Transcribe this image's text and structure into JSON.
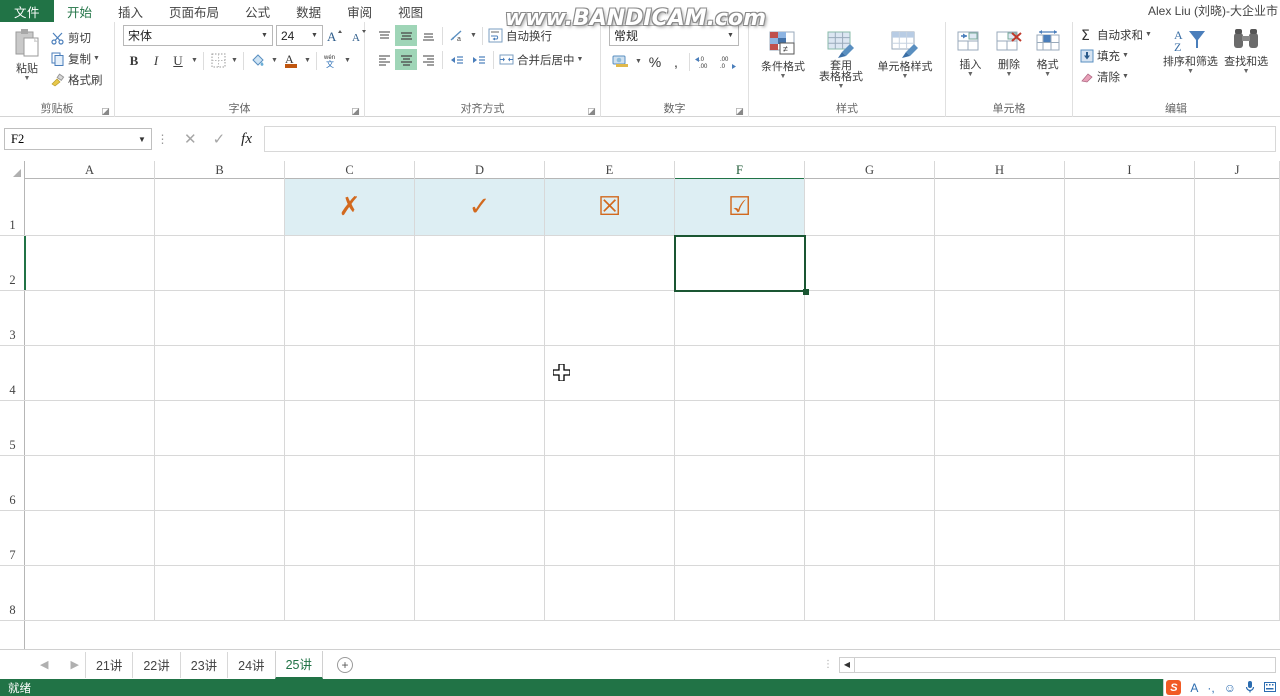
{
  "app": {
    "user_label": "Alex Liu (刘晓)-大企业市",
    "watermark": "www.BANDICAM.com"
  },
  "ribbon": {
    "tabs": [
      {
        "label": "文件",
        "kind": "file"
      },
      {
        "label": "开始",
        "kind": "active"
      },
      {
        "label": "插入",
        "kind": "normal"
      },
      {
        "label": "页面布局",
        "kind": "normal"
      },
      {
        "label": "公式",
        "kind": "normal"
      },
      {
        "label": "数据",
        "kind": "normal"
      },
      {
        "label": "审阅",
        "kind": "normal"
      },
      {
        "label": "视图",
        "kind": "normal"
      }
    ],
    "groups": {
      "clipboard": {
        "title": "剪贴板",
        "paste": "粘贴",
        "cut": "剪切",
        "copy": "复制",
        "format_painter": "格式刷"
      },
      "font": {
        "title": "字体",
        "font_name": "宋体",
        "font_size": "24",
        "grow": "A",
        "shrink": "A",
        "bold": "B",
        "italic": "I",
        "underline": "U"
      },
      "alignment": {
        "title": "对齐方式",
        "wrap_text": "自动换行",
        "merge_center": "合并后居中"
      },
      "number": {
        "title": "数字",
        "format": "常规",
        "percent": "%",
        "comma": ","
      },
      "styles": {
        "title": "样式",
        "conditional": "条件格式",
        "table_format_1": "套用",
        "table_format_2": "表格格式",
        "cell_styles": "单元格样式"
      },
      "cells": {
        "title": "单元格",
        "insert": "插入",
        "delete": "删除",
        "format": "格式"
      },
      "editing": {
        "title": "编辑",
        "autosum": "自动求和",
        "fill": "填充",
        "clear": "清除",
        "sort_filter": "排序和筛选",
        "find_select": "查找和选"
      }
    }
  },
  "formula_bar": {
    "name_box": "F2",
    "formula_value": "",
    "cancel_icon": "✕",
    "confirm_icon": "✓",
    "fx_icon": "fx"
  },
  "grid": {
    "columns": [
      "A",
      "B",
      "C",
      "D",
      "E",
      "F",
      "G",
      "H",
      "I",
      "J"
    ],
    "active_column": "F",
    "rows": [
      "1",
      "2",
      "3",
      "4",
      "5",
      "6",
      "7",
      "8"
    ],
    "active_row": "2",
    "active_cell": "F2",
    "row1_symbols": {
      "C": "✗",
      "D": "✓",
      "E": "☒",
      "F": "☑"
    },
    "symbol_color": "#d2691e",
    "selection_fill": "#ddeef3",
    "selection_border": "#1a5632"
  },
  "sheets": {
    "tabs": [
      "21讲",
      "22讲",
      "23讲",
      "24讲",
      "25讲"
    ],
    "active": "25讲",
    "add_label": "+",
    "prev_arrow": "◀",
    "next_arrow": "▶"
  },
  "status_bar": {
    "text": "就绪",
    "ime": {
      "logo": "S",
      "mode": "A",
      "punct": "·,",
      "emoji": "☺",
      "mic": "🎤"
    }
  },
  "theme": {
    "accent_green": "#217346",
    "ribbon_bg": "#ffffff",
    "toggle_on": "#9fd5b7"
  }
}
